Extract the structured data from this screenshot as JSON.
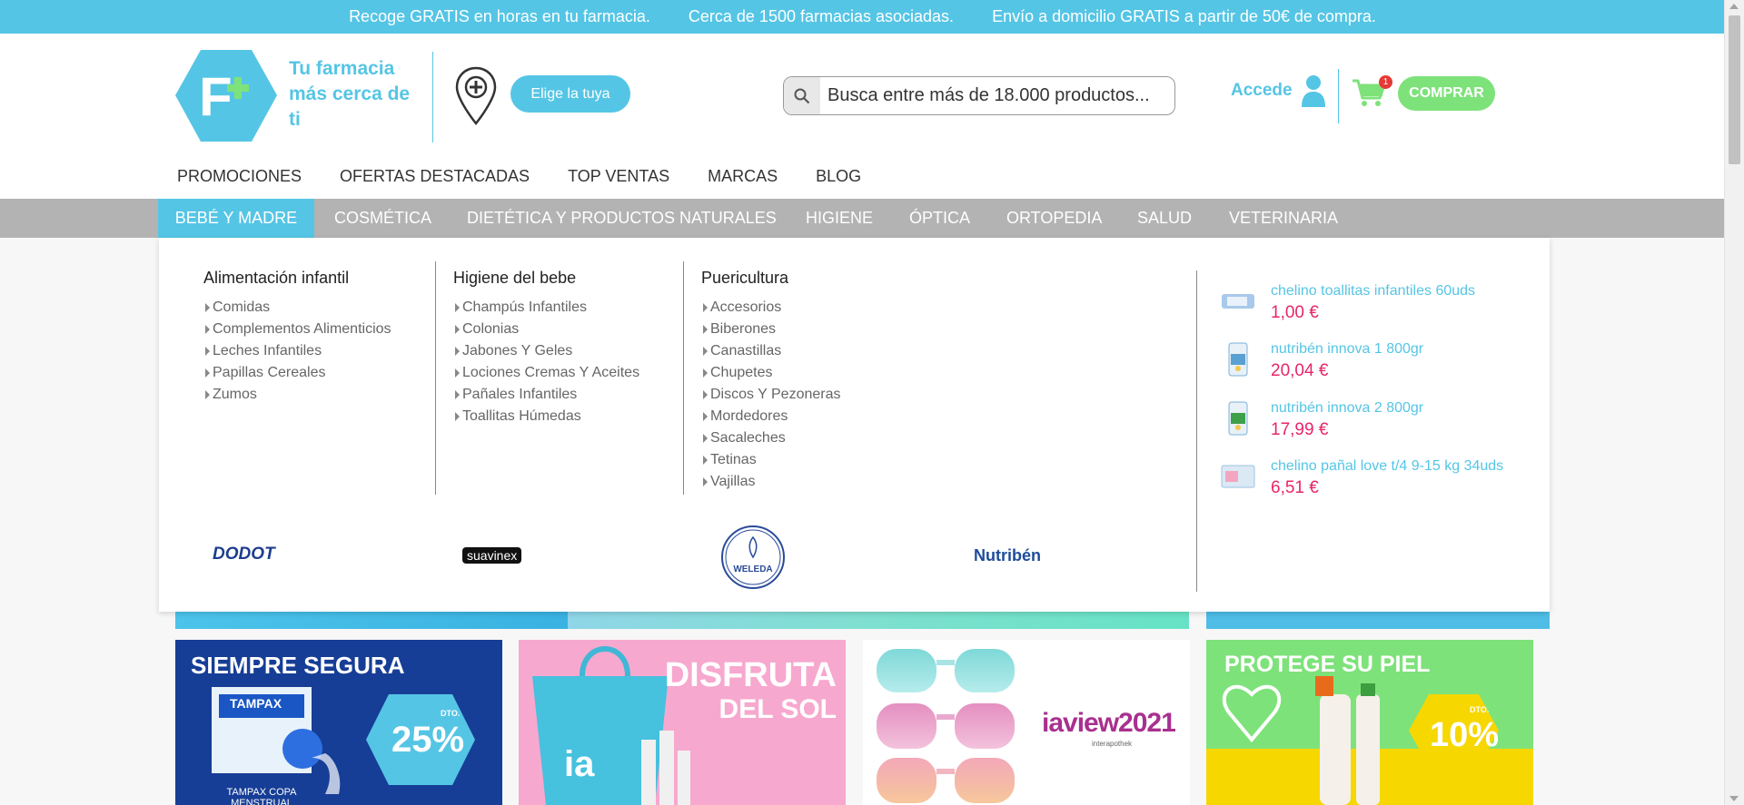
{
  "topbar": {
    "msg1": "Recoge GRATIS en horas en tu farmacia.",
    "msg2": "Cerca de 1500 farmacias asociadas.",
    "msg3": "Envío a domicilio GRATIS a partir de 50€ de compra."
  },
  "header": {
    "tagline": "Tu farmacia más cerca de ti",
    "elige_label": "Elige la tuya",
    "search_placeholder": "Busca entre más de 18.000 productos...",
    "accede_label": "Accede",
    "cart_count": "1",
    "comprar_label": "COMPRAR"
  },
  "nav_primary": [
    "PROMOCIONES",
    "OFERTAS DESTACADAS",
    "TOP VENTAS",
    "MARCAS",
    "BLOG"
  ],
  "nav_categories": [
    "BEBÉ Y MADRE",
    "COSMÉTICA",
    "DIETÉTICA Y PRODUCTOS NATURALES",
    "HIGIENE",
    "ÓPTICA",
    "ORTOPEDIA",
    "SALUD",
    "VETERINARIA"
  ],
  "dropdown": {
    "col1": {
      "title": "Alimentación infantil",
      "items": [
        "Comidas",
        "Complementos Alimenticios",
        "Leches Infantiles",
        "Papillas Cereales",
        "Zumos"
      ]
    },
    "col2": {
      "title": "Higiene del bebe",
      "items": [
        "Champús Infantiles",
        "Colonias",
        "Jabones Y Geles",
        "Lociones Cremas Y Aceites",
        "Pañales Infantiles",
        "Toallitas Húmedas"
      ]
    },
    "col3": {
      "title": "Puericultura",
      "items": [
        "Accesorios",
        "Biberones",
        "Canastillas",
        "Chupetes",
        "Discos Y Pezoneras",
        "Mordedores",
        "Sacaleches",
        "Tetinas",
        "Vajillas"
      ]
    },
    "brands": [
      "DODOT",
      "suavinex",
      "WELEDA",
      "Nutribén"
    ],
    "products": [
      {
        "name": "chelino toallitas infantiles 60uds",
        "price": "1,00 €"
      },
      {
        "name": "nutribén innova 1 800gr",
        "price": "20,04 €"
      },
      {
        "name": "nutribén innova 2 800gr",
        "price": "17,99 €"
      },
      {
        "name": "chelino pañal love t/4 9-15 kg 34uds",
        "price": "6,51 €"
      }
    ]
  },
  "cards": {
    "card1_title": "SIEMPRE SEGURA",
    "card1_pct": "25%",
    "card1_dto": "DTO.",
    "card1_brand": "TAMPAX",
    "card1_caption": "TAMPAX COPA MENSTRUAL",
    "card2_title1": "DISFRUTA",
    "card2_title2": "DEL SOL",
    "card3_brand": "iaview2021",
    "card3_sub": "interapothek",
    "card4_title": "PROTEGE SU PIEL",
    "card4_pct": "10%",
    "card4_dto": "DTO."
  },
  "colors": {
    "accent": "#55c5e5",
    "green": "#7ee27a",
    "price": "#e8256a",
    "navgray": "#b3b3b3"
  }
}
